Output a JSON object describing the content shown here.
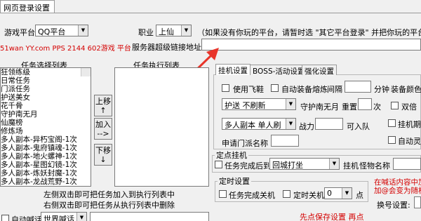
{
  "tab_label": "网页登录设置",
  "top": {
    "platform_label": "游戏平台",
    "platform_value": "QQ平台",
    "career_label": "职业",
    "career_value": "上仙",
    "hint": "（如果没有你玩的平台，请暂时选 \"其它平台登录\" 并把你玩的平台网址",
    "brand_text": "51wan YY.com PPS 2144 602游戏 平台",
    "server_url_label": "服务器超级链接地址",
    "server_url_value": ""
  },
  "lists": {
    "select_header": "任务选择列表",
    "exec_header": "任务执行列表",
    "select_items": [
      "狂领练级",
      "日常任务",
      "门派任务",
      "护送美女",
      "花千骨",
      "守护南无月",
      "仙魔榜",
      "修炼场",
      "多人副本-异朽宝阁-1次",
      "多人副本-鬼府镇魂-1次",
      "多人副本-地火螺神-1次",
      "多人副本-星图幻镜-1次",
      "多人副本-炼妖封魔-1次",
      "多人副本-龙战荒野-1次",
      "多人副本-瑶池斗仙-1次"
    ],
    "exec_items": [],
    "up_btn": "上移 ↑",
    "add_btn": "加入 -->",
    "down_btn": "下移 ↓",
    "hint1": "左侧双击即可把任务加入到执行列表中",
    "hint2": "右侧双击即可把任务从执行列表中删除"
  },
  "right": {
    "subtabs": [
      "挂机设置",
      "BOSS-活动设置",
      "强化设置"
    ],
    "use_fly": "使用飞鞋",
    "auto_smelt": "自动装备熔炼",
    "interval_label": "间隔",
    "minutes": "分钟",
    "equip_color": "装备颜色",
    "escort_value": "护送 不刷新",
    "guard_label": "守护南无月",
    "reset_label": "重置",
    "times": "次",
    "double": "双倍",
    "dungeon_value": "多人副本 单人刷",
    "power_label": "战力",
    "can_join": "可入队",
    "hangup_alert": "挂机期",
    "apply_label": "申请门派名称",
    "auto_soul": "自动灵",
    "timer_group": "定点挂机",
    "task_done_to": "任务完成后到",
    "hangup_map": "回城打坐",
    "hangup": "挂机",
    "monster_name": "怪物名称",
    "schedule_group": "定时设置",
    "task_done_shutdown": "任务完成关机",
    "timed_shutdown": "定时关机",
    "timed_value": "0",
    "point": "点",
    "red_note1": "在喊话内容中加",
    "red_note2": "加@会变为随机",
    "change_num": "换号设置:",
    "save_note": "先点保存设置 再点"
  },
  "bottom": {
    "auto_shout": "自动喊话",
    "channel_value": "世界喊话"
  }
}
